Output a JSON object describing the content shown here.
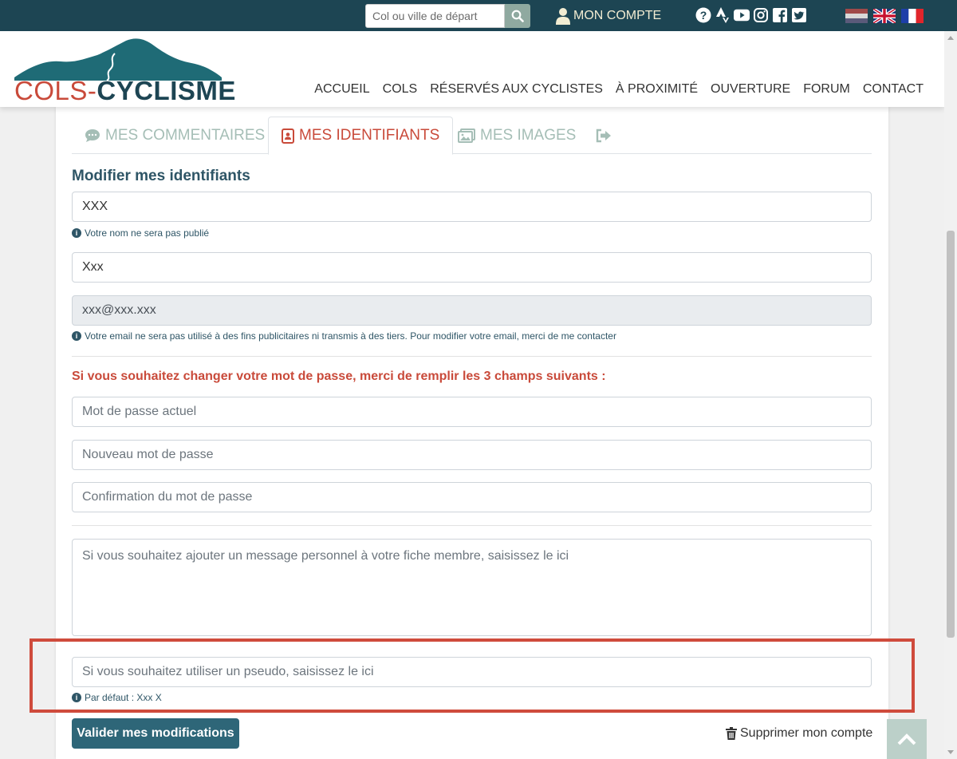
{
  "topbar": {
    "search": {
      "placeholder": "Col ou ville de départ"
    },
    "account_label": "MON COMPTE",
    "icons": [
      "help-icon",
      "strava-icon",
      "youtube-icon",
      "instagram-icon",
      "facebook-icon",
      "twitter-icon"
    ],
    "flags": [
      "nl-flag",
      "uk-flag",
      "fr-flag"
    ]
  },
  "brand": {
    "name_part1": "COLS",
    "separator": "-",
    "name_part2": "CYCLISME"
  },
  "nav": [
    "ACCUEIL",
    "COLS",
    "RÉSERVÉS AUX CYCLISTES",
    "À PROXIMITÉ",
    "OUVERTURE",
    "FORUM",
    "CONTACT"
  ],
  "tabs": [
    {
      "label": "MES COMMENTAIRES",
      "icon": "comment-icon",
      "active": false
    },
    {
      "label": "MES IDENTIFIANTS",
      "icon": "address-book-icon",
      "active": true
    },
    {
      "label": "MES IMAGES",
      "icon": "images-icon",
      "active": false
    },
    {
      "label": "",
      "icon": "logout-icon",
      "active": false
    }
  ],
  "form": {
    "title": "Modifier mes identifiants",
    "last_name": "XXX",
    "last_name_help": "Votre nom ne sera pas publié",
    "first_name": "Xxx",
    "email": "xxx@xxx.xxx",
    "email_help": "Votre email ne sera pas utilisé à des fins publicitaires ni transmis à des tiers. Pour modifier votre email, merci de me contacter",
    "password_note": "Si vous souhaitez changer votre mot de passe, merci de remplir les 3 champs suivants :",
    "current_password_placeholder": "Mot de passe actuel",
    "new_password_placeholder": "Nouveau mot de passe",
    "confirm_password_placeholder": "Confirmation du mot de passe",
    "message_placeholder": "Si vous souhaitez ajouter un message personnel à votre fiche membre, saisissez le ici",
    "pseudo_placeholder": "Si vous souhaitez utiliser un pseudo, saisissez le ici",
    "pseudo_help": "Par défaut : Xxx X",
    "submit_label": "Valider mes modifications",
    "delete_label": "Supprimer mon compte"
  },
  "colors": {
    "dark_teal": "#1d4553",
    "accent_red": "#c94a3a",
    "button_teal": "#2e6678",
    "muted_green": "#a5beb6"
  }
}
